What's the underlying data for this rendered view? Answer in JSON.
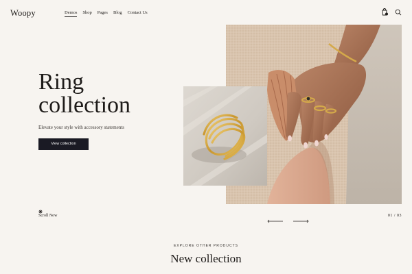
{
  "header": {
    "logo": "Woopy",
    "nav": [
      {
        "label": "Demos",
        "active": true
      },
      {
        "label": "Shop",
        "active": false
      },
      {
        "label": "Pages",
        "active": false
      },
      {
        "label": "Blog",
        "active": false
      },
      {
        "label": "Contact Us",
        "active": false
      }
    ],
    "icons": [
      "cart-icon",
      "search-icon"
    ]
  },
  "hero": {
    "title_line1": "Ring",
    "title_line2": "collection",
    "subtitle": "Elevate your style with accessory statements",
    "cta_label": "View collection",
    "cta_color": "#1a1a24",
    "scroll_label": "Scroll Now"
  },
  "slider": {
    "counter": "01 / 03",
    "current": 1,
    "total": 3
  },
  "section": {
    "eyebrow": "EXPLORE OTHER PRODUCTS",
    "title": "New collection"
  },
  "colors": {
    "background": "#f7f4f0",
    "text": "#1e1b19",
    "accent_gold": "#c9a03e"
  }
}
